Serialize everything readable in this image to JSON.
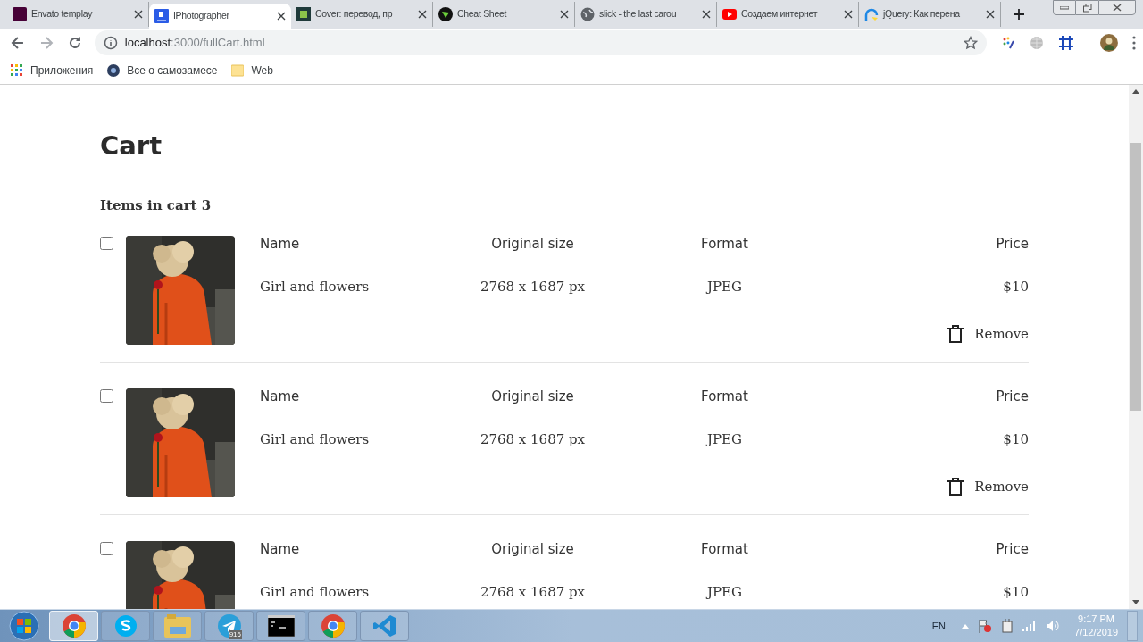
{
  "browser_tabs": [
    {
      "title": "Envato templay",
      "selected": false
    },
    {
      "title": "IPhotographer",
      "selected": true
    },
    {
      "title": "Cover: перевод, пр",
      "selected": false
    },
    {
      "title": "Cheat Sheet",
      "selected": false
    },
    {
      "title": "slick - the last carou",
      "selected": false
    },
    {
      "title": "Создаем интернет",
      "selected": false
    },
    {
      "title": "jQuery: Как перена",
      "selected": false
    }
  ],
  "address_bar": {
    "host": "localhost",
    "path": ":3000/fullCart.html"
  },
  "bookmarks": [
    "Приложения",
    "Все о самозамесе",
    "Web"
  ],
  "page": {
    "title": "Cart",
    "items_label": "Items in cart 3",
    "items": [
      {
        "checked": false,
        "headers": [
          "Name",
          "Original size",
          "Format",
          "Price"
        ],
        "name": "Girl and flowers",
        "size": "2768 x 1687 px",
        "format": "JPEG",
        "price": "$10",
        "remove": "Remove"
      },
      {
        "checked": false,
        "headers": [
          "Name",
          "Original size",
          "Format",
          "Price"
        ],
        "name": "Girl and flowers",
        "size": "2768 x 1687 px",
        "format": "JPEG",
        "price": "$10",
        "remove": "Remove"
      },
      {
        "checked": false,
        "headers": [
          "Name",
          "Original size",
          "Format",
          "Price"
        ],
        "name": "Girl and flowers",
        "size": "2768 x 1687 px",
        "format": "JPEG",
        "price": "$10"
      }
    ]
  },
  "taskbar": {
    "apps": [
      {
        "selected": true
      },
      {
        "selected": false
      },
      {
        "selected": false
      },
      {
        "selected": false,
        "badge": "916"
      },
      {
        "selected": false
      },
      {
        "selected": false
      },
      {
        "selected": false
      }
    ],
    "language": "EN",
    "time": "9:17 PM",
    "date": "7/12/2019"
  }
}
